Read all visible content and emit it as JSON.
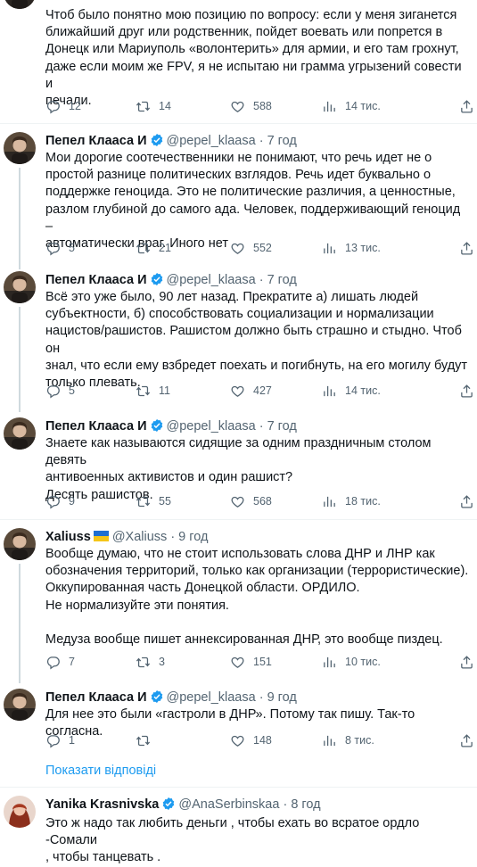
{
  "colors": {
    "accent": "#1d9bf0",
    "text": "#0f1419",
    "muted": "#536471",
    "verified": "#1d9bf0"
  },
  "tweets": [
    {
      "name": "",
      "handle": "",
      "time": "",
      "text": "Чтоб было понятно мою позицию по вопросу: если у меня зиганется\nближайший друг или родственник, пойдет воевать или попрется в\nДонецк или Мариуполь «волонтерить» для армии, и его там грохнут,\nдаже если моим же FPV, я не испытаю ни грамма угрызений совести и\nпечали.",
      "replies": "12",
      "retweets": "14",
      "likes": "588",
      "views": "14 тис."
    },
    {
      "name": "Пепел Клааса",
      "handle": "@pepel_klaasa",
      "time": "· 7 год",
      "text": "Мои дорогие соотечественники не понимают, что речь идет не о\nпростой разнице политических взглядов. Речь идет буквально о\nподдержке геноцида. Это не политические различия, а ценностные,\nразлом глубиной до самого ада. Человек, поддерживающий геноцид –\nавтоматически враг. Иного нет",
      "replies": "5",
      "retweets": "21",
      "likes": "552",
      "views": "13 тис."
    },
    {
      "name": "Пепел Клааса",
      "handle": "@pepel_klaasa",
      "time": "· 7 год",
      "text": "Всё это уже было, 90 лет назад. Прекратите а) лишать людей\nсубъектности, б) способствовать социализации и нормализации\nнацистов/рашистов. Рашистом должно быть страшно и стыдно. Чтоб он\nзнал, что если ему взбредет поехать и погибнуть, на его могилу будут\nтолько плевать.",
      "replies": "5",
      "retweets": "11",
      "likes": "427",
      "views": "14 тис."
    },
    {
      "name": "Пепел Клааса",
      "handle": "@pepel_klaasa",
      "time": "· 7 год",
      "text": "Знаете как называются сидящие за одним праздничным столом девять\nантивоенных активистов и один рашист?\nДесять рашистов.",
      "replies": "9",
      "retweets": "55",
      "likes": "568",
      "views": "18 тис."
    },
    {
      "name": "Xaliuss",
      "handle": "@Xaliuss",
      "time": "· 9 год",
      "text": "Вообще думаю, что не стоит использовать слова ДНР и ЛНР как\nобозначения территорий, только как организации (террористические).\nОккупированная часть Донецкой области. ОРДИЛО.\nНе нормализуйте эти понятия.\n\nМедуза вообще пишет аннексированная ДНР, это вообще пиздец.",
      "replies": "7",
      "retweets": "3",
      "likes": "151",
      "views": "10 тис."
    },
    {
      "name": "Пепел Клааса",
      "handle": "@pepel_klaasa",
      "time": "· 9 год",
      "text": "Для нее это были «гастроли в ДНР». Потому так пишу. Так-то согласна.",
      "replies": "1",
      "retweets": "",
      "likes": "148",
      "views": "8 тис."
    },
    {
      "name": "Yanika Krasnivska",
      "handle": "@AnaSerbinskaa",
      "time": "· 8 год",
      "text": "Это ж надо так любить деньги , чтобы ехать во всратое ордло -Сомали\n, чтобы танцевать ."
    }
  ],
  "show_more": "Показати відповіді",
  "icons": {
    "reply": "reply-icon",
    "retweet": "retweet-icon",
    "like": "heart-icon",
    "views": "views-icon",
    "share": "share-icon",
    "verified": "verified-badge-icon",
    "flag": "ukraine-flag-icon"
  }
}
